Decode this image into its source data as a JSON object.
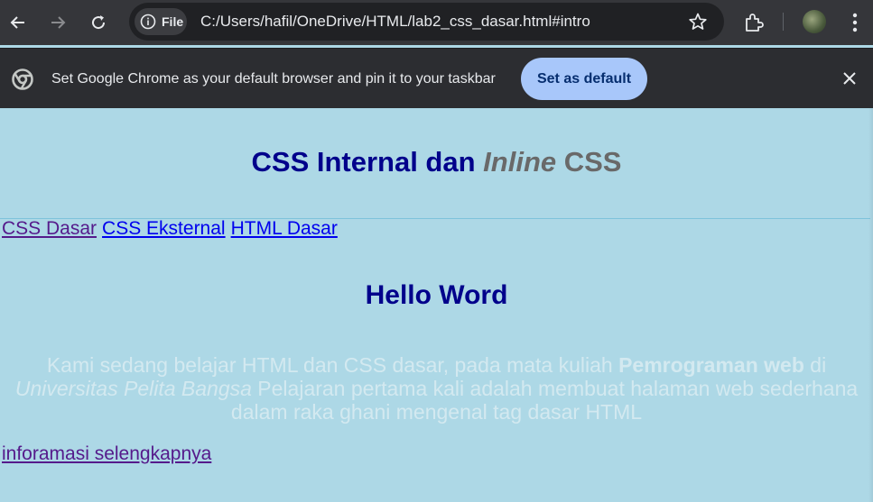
{
  "browser": {
    "site_chip_label": "File",
    "url": "C:/Users/hafil/OneDrive/HTML/lab2_css_dasar.html#intro",
    "infobar_text": "Set Google Chrome as your default browser and pin it to your taskbar",
    "set_default_label": "Set as default"
  },
  "page": {
    "title_part1": "CSS Internal dan ",
    "title_italic": "Inline",
    "title_part2": " CSS",
    "nav_links": [
      "CSS Dasar",
      "CSS Eksternal",
      "HTML Dasar"
    ],
    "hello_heading": "Hello Word",
    "paragraph": {
      "text1": "Kami sedang belajar HTML dan CSS dasar, pada mata kuliah ",
      "bold": "Pemrograman web",
      "text2": " di ",
      "italic": "Universitas Pelita Bangsa",
      "text3": " Pelajaran pertama kali adalah membuat halaman web sederhana dalam raka ghani mengenal tag dasar HTML"
    },
    "more_link": "inforamasi selengkapnya"
  },
  "colors": {
    "page_background": "#add8e6",
    "heading": "#00008b",
    "muted_heading": "#696969",
    "visited_link": "#551a8b",
    "link": "#0000ee",
    "paragraph_text": "#d3e9f0",
    "button_background": "#a8c7fa"
  },
  "icons": [
    "back-arrow-icon",
    "forward-arrow-icon",
    "reload-icon",
    "info-icon",
    "star-icon",
    "extensions-icon",
    "avatar",
    "more-vert-icon",
    "chrome-logo-icon",
    "close-icon"
  ]
}
